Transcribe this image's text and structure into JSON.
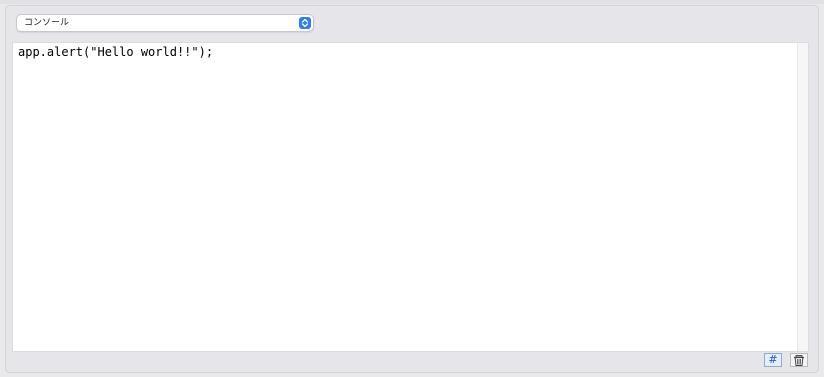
{
  "console_select": {
    "selected": "コンソール"
  },
  "editor": {
    "code_lines": [
      "app.alert(\"Hello world!!\");"
    ]
  },
  "toolbar": {
    "line_numbers_symbol": "#",
    "line_numbers_icon": "hash-icon",
    "clear_icon": "trash-icon"
  },
  "colors": {
    "accent": "#2f7cf6",
    "background": "#e9e9ec",
    "editor_bg": "#ffffff"
  }
}
